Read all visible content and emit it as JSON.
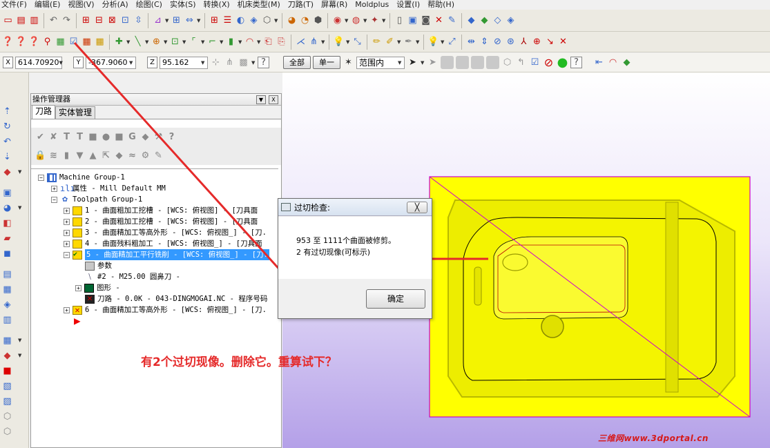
{
  "menu": [
    "文件(F)",
    "编辑(E)",
    "视图(V)",
    "分析(A)",
    "绘图(C)",
    "实体(S)",
    "转换(X)",
    "机床类型(M)",
    "刀路(T)",
    "屏幕(R)",
    "Moldplus",
    "设置(I)",
    "帮助(H)"
  ],
  "coords": {
    "x_label": "X",
    "x_value": "614.70920",
    "y_label": "Y",
    "y_value": "-367.9060",
    "z_label": "Z",
    "z_value": "95.162",
    "all_button": "全部",
    "single_button": "单一",
    "range_select": "范围内"
  },
  "manager": {
    "title": "操作管理器",
    "tabs": [
      "刀路",
      "实体管理"
    ],
    "tree": {
      "machine_group": "Machine Group-1",
      "properties": "属性 - Mill Default MM",
      "toolpath_group": "Toolpath Group-1",
      "op1": "1 - 曲面粗加工挖槽 - [WCS: 俯视图] - [刀具面",
      "op2": "2 - 曲面粗加工挖槽 - [WCS: 俯视图] - [刀具面",
      "op3": "3 - 曲面精加工等高外形 - [WCS: 俯视图_] - [刀.",
      "op4": "4 - 曲面残料粗加工 - [WCS: 俯视图_] - [刀具面",
      "op5": "5 - 曲面精加工平行铣削 - [WCS: 俯视图_] - [刀.",
      "op5_params": "参数",
      "op5_tool": "#2 - M25.00 圆鼻刀 -",
      "op5_geom": "图形 -",
      "op5_path": "刀路 - 0.0K - 043-DINGMOGAI.NC - 程序号码",
      "op6": "6 - 曲面精加工等高外形 - [WCS: 俯视图_] - [刀."
    }
  },
  "dialog": {
    "title": "过切检查:",
    "close": "╳",
    "line1": "953  至 1111个曲面被修剪。",
    "line2": "2 有过切现像(可标示)",
    "ok": "确定"
  },
  "annotation": "有2个过切现像。删除它。重算试下？",
  "watermark": "三维网www.3dportal.cn",
  "colors": {
    "part": "#ffff00",
    "selection": "#3399ff",
    "annotation": "#e52a2a",
    "trim_line": "#cc00cc"
  }
}
